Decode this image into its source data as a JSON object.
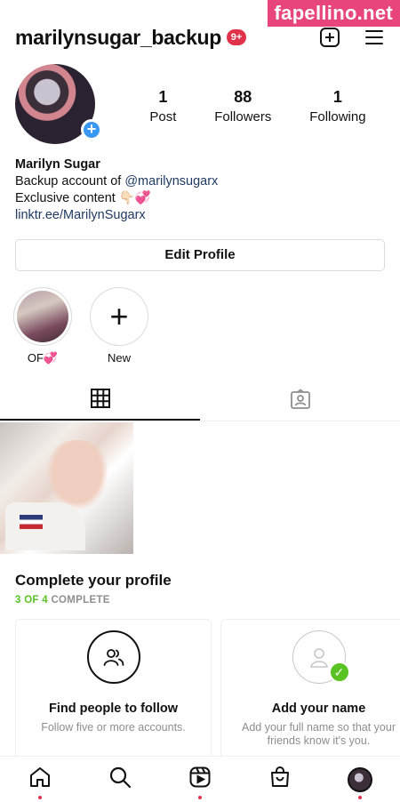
{
  "watermark": "fapellino.net",
  "header": {
    "username": "marilynsugar_backup",
    "notification_badge": "9+",
    "icons": [
      "new-post-icon",
      "menu-icon"
    ]
  },
  "profile": {
    "avatar_plus": "+",
    "stats": [
      {
        "num": "1",
        "label": "Post"
      },
      {
        "num": "88",
        "label": "Followers"
      },
      {
        "num": "1",
        "label": "Following"
      }
    ]
  },
  "bio": {
    "name": "Marilyn Sugar",
    "line1_prefix": "Backup account of ",
    "line1_handle": "@marilynsugarx",
    "line2": "Exclusive content 👇🏻💞",
    "link": "linktr.ee/MarilynSugarx"
  },
  "edit_profile_label": "Edit Profile",
  "highlights": [
    {
      "label": "OF💞",
      "type": "image"
    },
    {
      "label": "New",
      "type": "add",
      "glyph": "+"
    }
  ],
  "tabs": [
    "grid-icon",
    "tagged-icon"
  ],
  "complete_profile": {
    "title": "Complete your profile",
    "progress_done": "3 OF 4",
    "progress_rest": " COMPLETE",
    "cards": [
      {
        "title": "Find people to follow",
        "sub": "Follow five or more accounts.",
        "icon": "people-icon"
      },
      {
        "title": "Add your name",
        "sub": "Add your full name so that your friends know it's you.",
        "icon": "person-icon",
        "check": "✓"
      }
    ]
  },
  "bottom_nav": [
    "home-icon",
    "search-icon",
    "reels-icon",
    "shop-icon",
    "profile-avatar"
  ],
  "colors": {
    "accent": "#3897f0",
    "badge": "#e0334b",
    "complete": "#58c322",
    "watermark": "#e8457c"
  }
}
